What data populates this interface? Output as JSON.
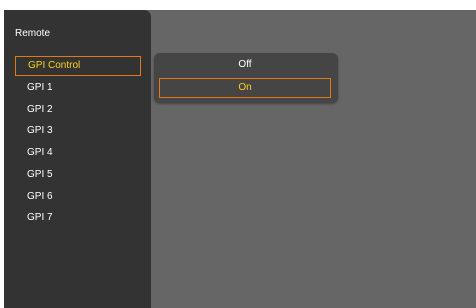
{
  "sidebar": {
    "title": "Remote",
    "items": [
      {
        "label": "GPI Control"
      },
      {
        "label": "GPI 1"
      },
      {
        "label": "GPI 2"
      },
      {
        "label": "GPI 3"
      },
      {
        "label": "GPI 4"
      },
      {
        "label": "GPI 5"
      },
      {
        "label": "GPI 6"
      },
      {
        "label": "GPI 7"
      }
    ],
    "selected_index": 0
  },
  "popup": {
    "options": [
      {
        "label": "Off"
      },
      {
        "label": "On"
      }
    ],
    "selected_index": 1
  },
  "colors": {
    "panel_background": "#333333",
    "content_background": "#666666",
    "popup_background": "#454545",
    "highlight_border": "#e07a17",
    "highlight_text": "#ffd21e",
    "text": "#ffffff"
  }
}
